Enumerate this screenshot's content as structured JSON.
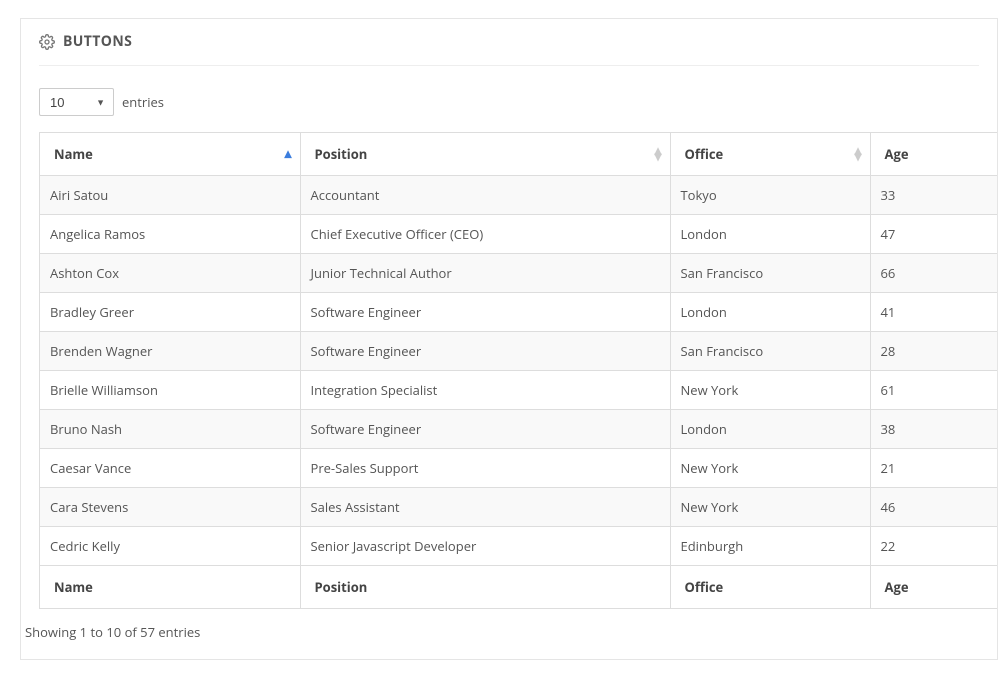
{
  "header": {
    "title": "BUTTONS"
  },
  "length": {
    "selected": "10",
    "label": "entries"
  },
  "columns": [
    {
      "key": "name",
      "label": "Name",
      "sorted": "asc"
    },
    {
      "key": "position",
      "label": "Position",
      "sorted": "both"
    },
    {
      "key": "office",
      "label": "Office",
      "sorted": "both"
    },
    {
      "key": "age",
      "label": "Age",
      "sorted": "both"
    }
  ],
  "rows": [
    {
      "name": "Airi Satou",
      "position": "Accountant",
      "office": "Tokyo",
      "age": "33"
    },
    {
      "name": "Angelica Ramos",
      "position": "Chief Executive Officer (CEO)",
      "office": "London",
      "age": "47"
    },
    {
      "name": "Ashton Cox",
      "position": "Junior Technical Author",
      "office": "San Francisco",
      "age": "66"
    },
    {
      "name": "Bradley Greer",
      "position": "Software Engineer",
      "office": "London",
      "age": "41"
    },
    {
      "name": "Brenden Wagner",
      "position": "Software Engineer",
      "office": "San Francisco",
      "age": "28"
    },
    {
      "name": "Brielle Williamson",
      "position": "Integration Specialist",
      "office": "New York",
      "age": "61"
    },
    {
      "name": "Bruno Nash",
      "position": "Software Engineer",
      "office": "London",
      "age": "38"
    },
    {
      "name": "Caesar Vance",
      "position": "Pre-Sales Support",
      "office": "New York",
      "age": "21"
    },
    {
      "name": "Cara Stevens",
      "position": "Sales Assistant",
      "office": "New York",
      "age": "46"
    },
    {
      "name": "Cedric Kelly",
      "position": "Senior Javascript Developer",
      "office": "Edinburgh",
      "age": "22"
    }
  ],
  "footer_labels": {
    "name": "Name",
    "position": "Position",
    "office": "Office",
    "age": "Age"
  },
  "info": "Showing 1 to 10 of 57 entries"
}
